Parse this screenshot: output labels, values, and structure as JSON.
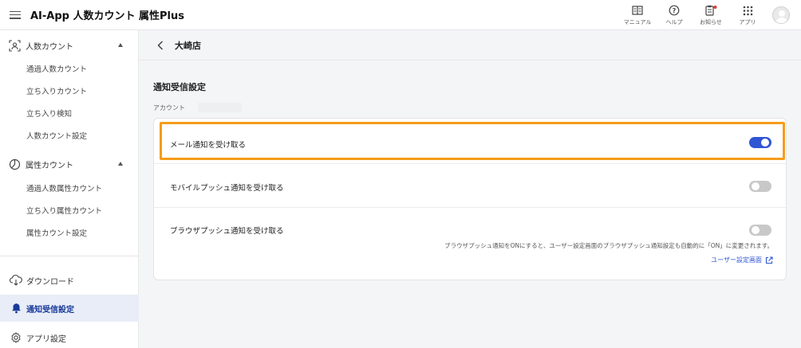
{
  "header": {
    "title": "AI-App 人数カウント 属性Plus",
    "icons": [
      {
        "name": "manual-icon",
        "label": "マニュアル"
      },
      {
        "name": "help-icon",
        "label": "ヘルプ"
      },
      {
        "name": "notice-icon",
        "label": "お知らせ"
      },
      {
        "name": "apps-icon",
        "label": "アプリ"
      }
    ],
    "notice_dot_color": "#e53935"
  },
  "sidebar": {
    "groups": [
      {
        "label": "人数カウント",
        "icon": "people-count-icon",
        "expanded": true,
        "items": [
          "通過人数カウント",
          "立ち入りカウント",
          "立ち入り検知",
          "人数カウント設定"
        ]
      },
      {
        "label": "属性カウント",
        "icon": "attribute-chart-icon",
        "expanded": true,
        "items": [
          "通過人数属性カウント",
          "立ち入り属性カウント",
          "属性カウント設定"
        ]
      }
    ],
    "bottom_items": [
      {
        "label": "ダウンロード",
        "icon": "cloud-download-icon",
        "active": false
      },
      {
        "label": "通知受信設定",
        "icon": "bell-icon",
        "active": true
      },
      {
        "label": "アプリ設定",
        "icon": "gear-icon",
        "active": false
      }
    ]
  },
  "subheader": {
    "store_name": "大崎店"
  },
  "main": {
    "section_title": "通知受信設定",
    "account_label": "アカウント",
    "account_value": "",
    "settings": [
      {
        "label": "メール通知を受け取る",
        "enabled": true,
        "highlighted": true
      },
      {
        "label": "モバイルプッシュ通知を受け取る",
        "enabled": false
      },
      {
        "label": "ブラウザプッシュ通知を受け取る",
        "enabled": false
      }
    ],
    "browser_note": "ブラウザプッシュ通知をONにすると、ユーザー設定画面のブラウザプッシュ通知設定も自動的に「ON」に変更されます。",
    "user_settings_link": "ユーザー設定画面"
  },
  "colors": {
    "accent": "#2f55d4",
    "highlight": "#f59c1a",
    "active_bg": "#e8edf7"
  }
}
